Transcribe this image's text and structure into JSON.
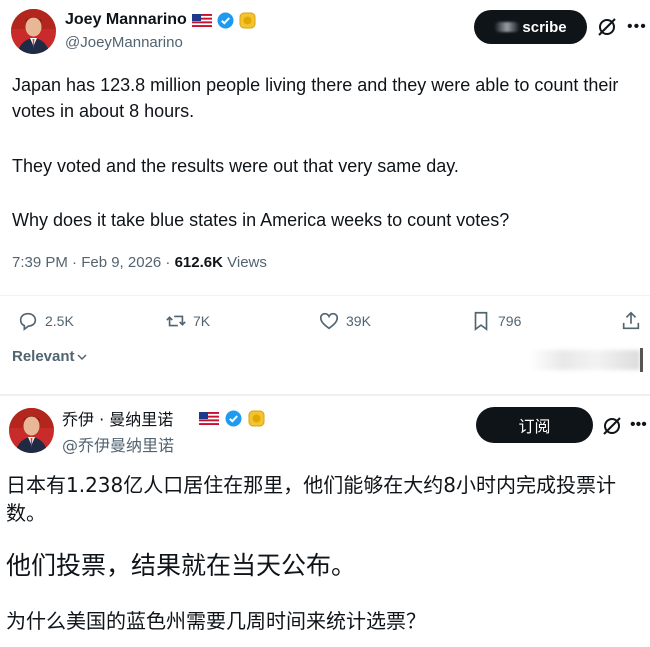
{
  "original_tweet": {
    "author_name": "Joey Mannarino",
    "handle": "@JoeyMannarino",
    "subscribe_label": "scribe",
    "paragraphs": [
      "Japan has 123.8 million people living there and they were able to count their votes in about 8 hours.",
      "They voted and the results were out that very same day.",
      "Why does it take blue states in America weeks to count votes?"
    ],
    "timestamp": "7:39 PM · Feb 9, 2026 · ",
    "views_count": "612.6K",
    "views_label": " Views",
    "actions": {
      "replies": "2.5K",
      "reposts": "7K",
      "likes": "39K",
      "bookmarks": "796"
    },
    "sort_label": "Relevant",
    "colors": {
      "text": "#0f1419",
      "muted": "#536471",
      "verified": "#1d9bf0",
      "gold_badge": "#f4c430"
    },
    "icons": [
      "reply-icon",
      "repost-icon",
      "like-icon",
      "bookmark-icon",
      "share-icon",
      "grok-icon",
      "more-icon"
    ]
  },
  "translated_tweet": {
    "author_name": "乔伊 · 曼纳里诺",
    "handle": "@乔伊曼纳里诺",
    "subscribe_label": "订阅",
    "paragraphs": [
      "日本有1.238亿人口居住在那里，他们能够在大约8小时内完成投票计数。",
      "他们投票，结果就在当天公布。",
      "为什么美国的蓝色州需要几周时间来统计选票？"
    ]
  }
}
